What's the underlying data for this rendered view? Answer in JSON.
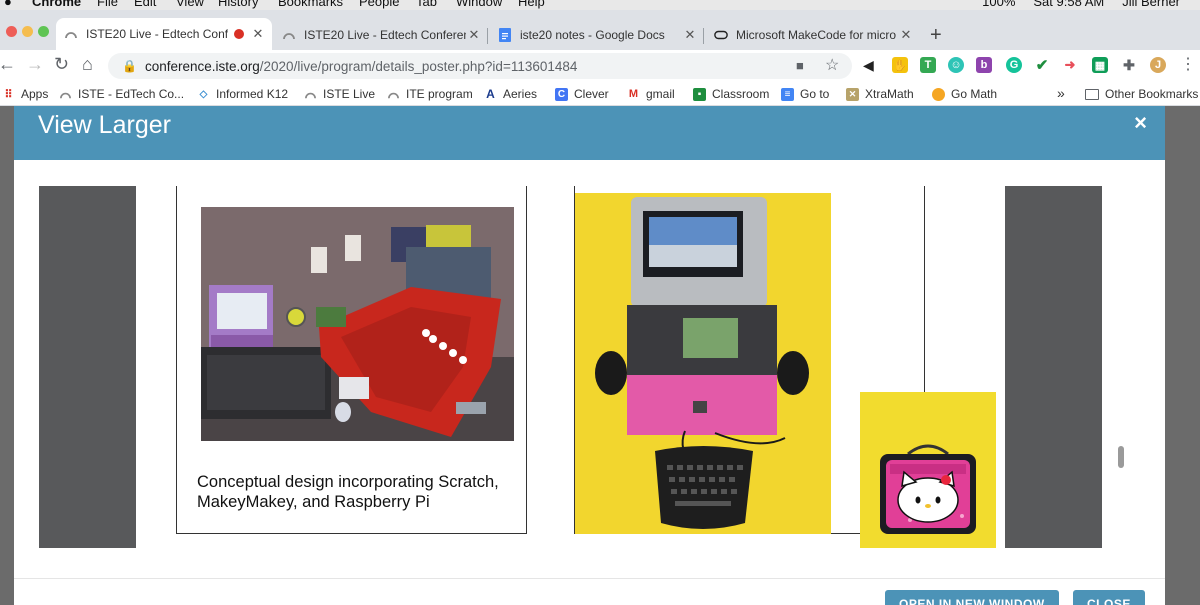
{
  "os_menubar": {
    "app": "Chrome",
    "items": [
      "File",
      "Edit",
      "View",
      "History",
      "Bookmarks",
      "People",
      "Tab",
      "Window",
      "Help"
    ],
    "battery": "100%",
    "clock": "Sat 9:58 AM",
    "user": "Jill Berner"
  },
  "tabs": [
    {
      "title": "ISTE20 Live - Edtech Conf",
      "active": true,
      "recording": true
    },
    {
      "title": "ISTE20 Live - Edtech Conferen",
      "active": false
    },
    {
      "title": "iste20 notes - Google Docs",
      "active": false
    },
    {
      "title": "Microsoft MakeCode for micro",
      "active": false
    }
  ],
  "toolbar": {
    "url_host": "conference.iste.org",
    "url_path": "/2020/live/program/details_poster.php?id=113601484"
  },
  "bookmarks": [
    {
      "label": "Apps",
      "icon": "apps-grid-icon"
    },
    {
      "label": "ISTE - EdTech Co...",
      "icon": "iste-icon"
    },
    {
      "label": "Informed K12",
      "icon": "informed-icon"
    },
    {
      "label": "ISTE Live",
      "icon": "iste-icon"
    },
    {
      "label": "ITE program",
      "icon": "iste-icon"
    },
    {
      "label": "Aeries",
      "icon": "aeries-icon"
    },
    {
      "label": "Clever",
      "icon": "clever-icon"
    },
    {
      "label": "gmail",
      "icon": "gmail-icon"
    },
    {
      "label": "Classroom",
      "icon": "classroom-icon"
    },
    {
      "label": "Go to",
      "icon": "docs-icon"
    },
    {
      "label": "XtraMath",
      "icon": "xtramath-icon"
    },
    {
      "label": "Go Math",
      "icon": "gomath-icon"
    }
  ],
  "bookmarks_overflow": "»",
  "other_bookmarks": "Other Bookmarks",
  "modal": {
    "title": "View Larger",
    "close_glyph": "×",
    "poster_caption_line1": "Conceptual design incorporating Scratch,",
    "poster_caption_line2": "MakeyMakey,  and Raspberry Pi",
    "open_button": "OPEN IN NEW WINDOW",
    "close_button": "CLOSE"
  },
  "colors": {
    "modal_header": "#4c93b7",
    "poster_side": "#58595b",
    "photo_yellow": "#f2d62e"
  }
}
